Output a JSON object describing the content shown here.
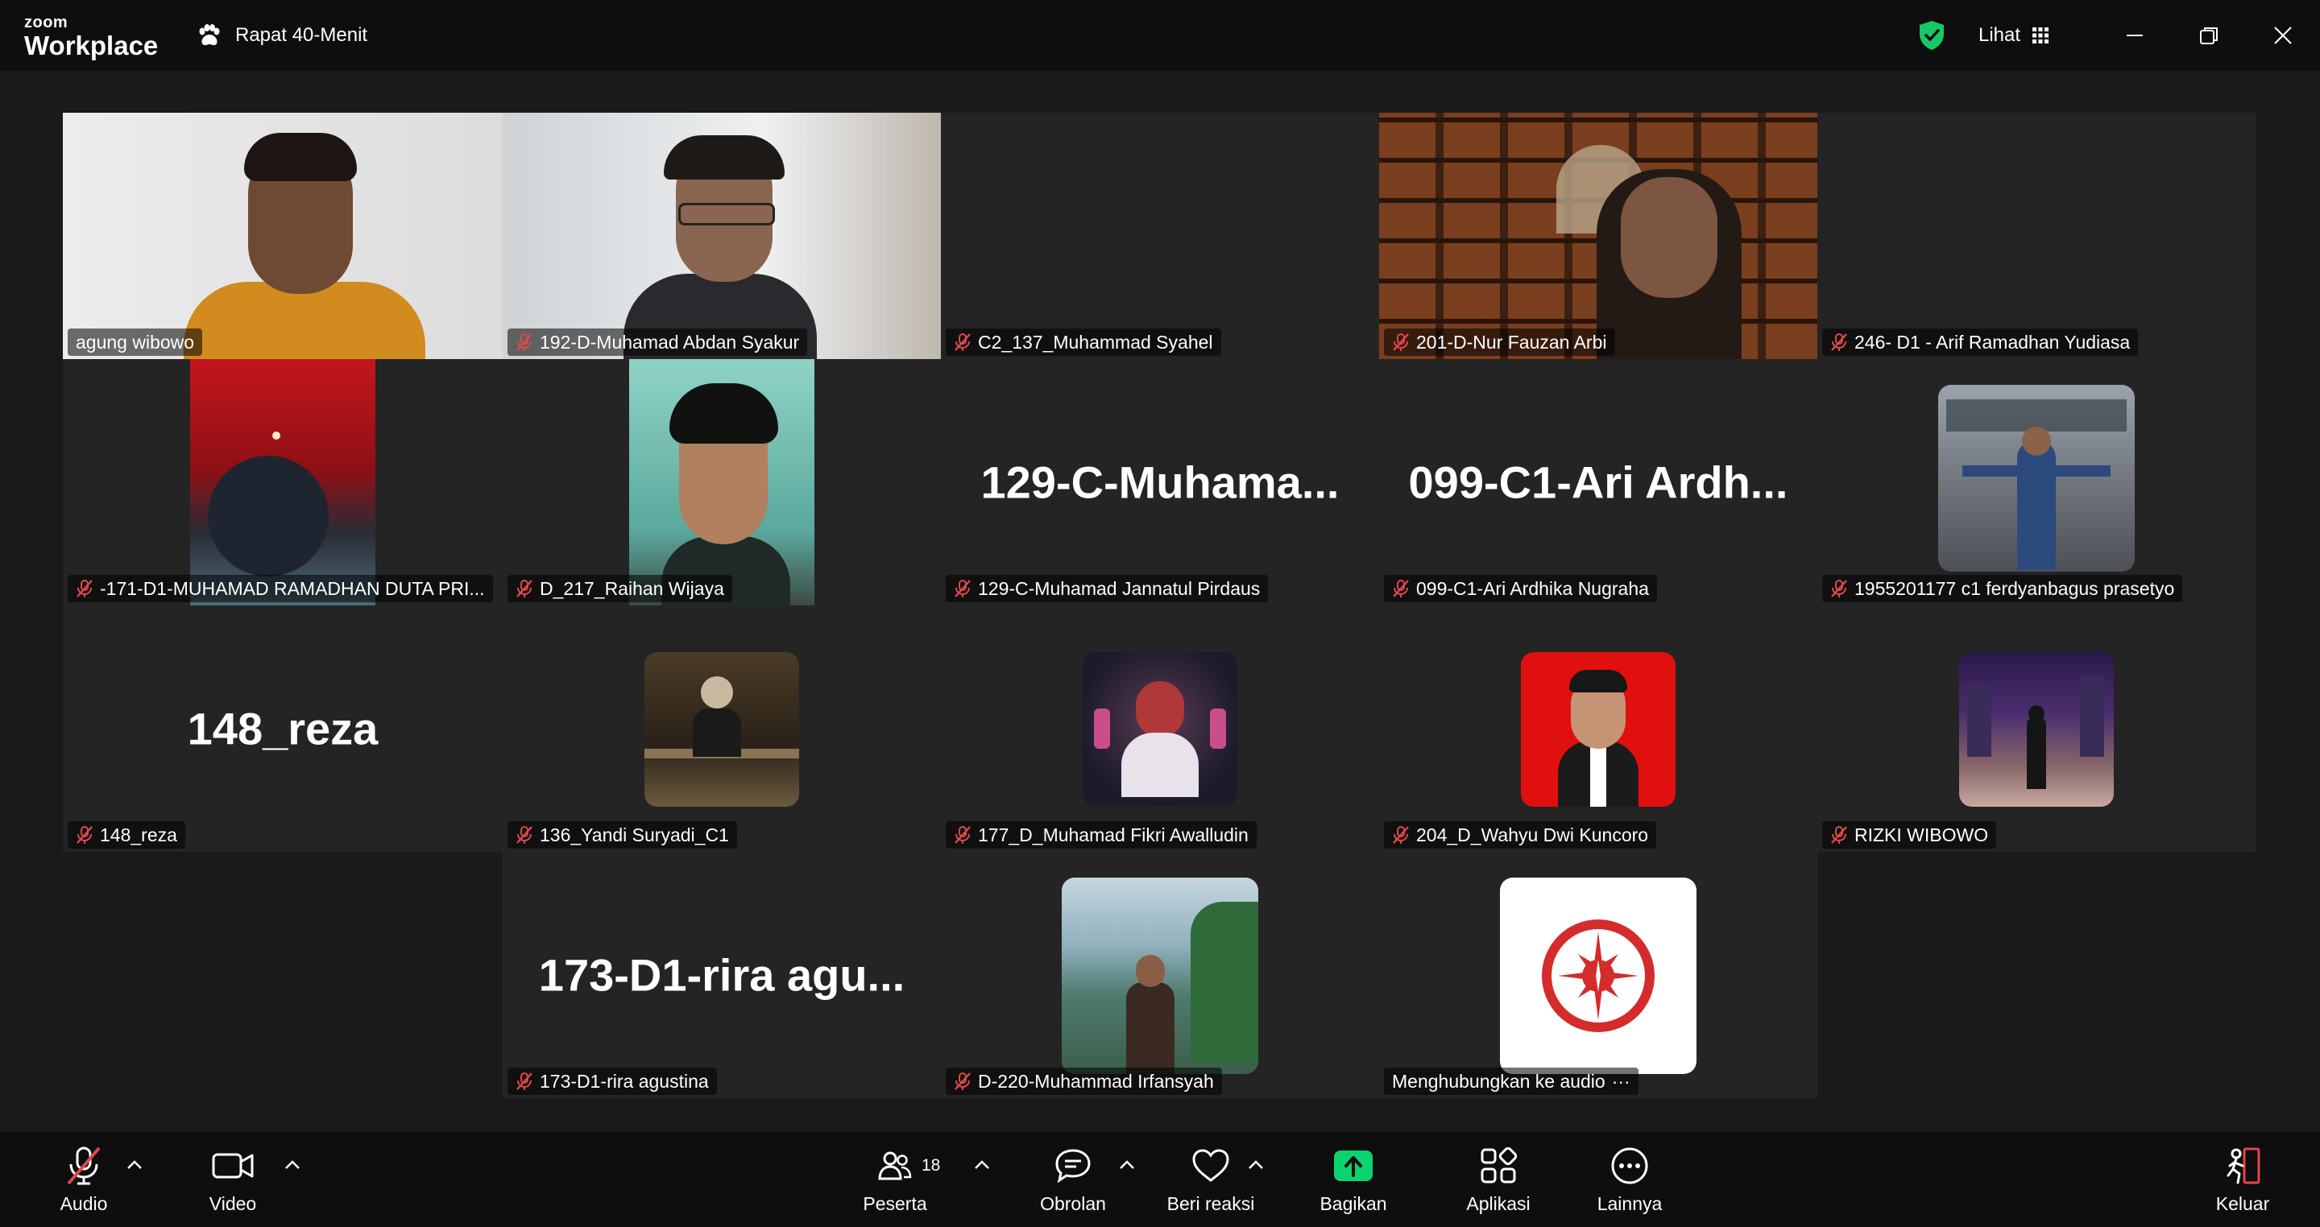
{
  "app": {
    "brand_top": "zoom",
    "brand_bottom": "Workplace",
    "meeting_title": "Rapat 40-Menit",
    "view_label": "Lihat"
  },
  "participants": [
    {
      "name": "agung wibowo",
      "muted": false,
      "display": "video"
    },
    {
      "name": "192-D-Muhamad Abdan Syakur",
      "muted": true,
      "display": "video"
    },
    {
      "name": "C2_137_Muhammad Syahel",
      "muted": true,
      "display": "blank"
    },
    {
      "name": "201-D-Nur Fauzan Arbi",
      "muted": true,
      "display": "video"
    },
    {
      "name": "246- D1 - Arif Ramadhan Yudiasa",
      "muted": true,
      "display": "blank"
    },
    {
      "name": "-171-D1-MUHAMAD RAMADHAN DUTA PRI...",
      "muted": true,
      "display": "video"
    },
    {
      "name": "D_217_Raihan Wijaya",
      "muted": true,
      "display": "video"
    },
    {
      "name": "129-C-Muhamad Jannatul Pirdaus",
      "big_name": "129-C-Muhama...",
      "muted": true,
      "display": "name"
    },
    {
      "name": "099-C1-Ari Ardhika Nugraha",
      "big_name": "099-C1-Ari  Ardh...",
      "muted": true,
      "display": "name"
    },
    {
      "name": "1955201177 c1 ferdyanbagus prasetyo",
      "muted": true,
      "display": "avatar"
    },
    {
      "name": "148_reza",
      "big_name": "148_reza",
      "muted": true,
      "display": "name"
    },
    {
      "name": "136_Yandi Suryadi_C1",
      "muted": true,
      "display": "avatar"
    },
    {
      "name": "177_D_Muhamad Fikri Awalludin",
      "muted": true,
      "display": "avatar"
    },
    {
      "name": "204_D_Wahyu Dwi Kuncoro",
      "muted": true,
      "display": "avatar"
    },
    {
      "name": "RIZKI WIBOWO",
      "muted": true,
      "display": "avatar"
    },
    {
      "name": "173-D1-rira agustina",
      "big_name": "173-D1-rira  agu...",
      "muted": true,
      "display": "name"
    },
    {
      "name": "D-220-Muhammad Irfansyah",
      "muted": true,
      "display": "avatar"
    },
    {
      "name": "Menghubungkan ke audio",
      "status_suffix": "···",
      "muted": false,
      "display": "avatar"
    }
  ],
  "toolbar": {
    "audio": "Audio",
    "video": "Video",
    "participants": "Peserta",
    "participants_count": "18",
    "chat": "Obrolan",
    "react": "Beri reaksi",
    "share": "Bagikan",
    "apps": "Aplikasi",
    "more": "Lainnya",
    "leave": "Keluar"
  },
  "colors": {
    "active_speaker": "#23d18b",
    "share_green": "#0bd46e",
    "muted_red": "#e0484a",
    "leave_red": "#e0484a",
    "shield_green": "#17c964"
  }
}
